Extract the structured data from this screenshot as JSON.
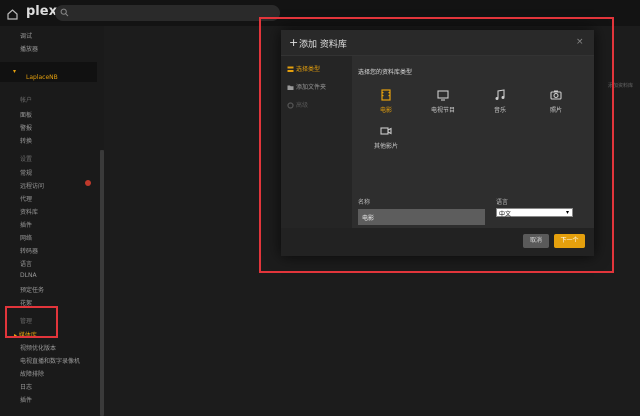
{
  "topbar": {
    "logo": "plex"
  },
  "sidebar": {
    "top_items": [
      "调试",
      "播放器"
    ],
    "server": "LaplaceNB",
    "section1": {
      "header": "帐户",
      "items": [
        "面板",
        "警报",
        "转换"
      ]
    },
    "section2": {
      "header": "设置",
      "items": [
        "常规",
        "远程访问",
        "代理",
        "资料库",
        "插件",
        "网络",
        "转码器",
        "语言",
        "DLNA",
        "预定任务",
        "花絮"
      ]
    },
    "section3": {
      "header": "管理",
      "items": [
        "媒体库",
        "视频优化版本",
        "电视直播和数字录像机",
        "故障排除",
        "日志",
        "插件"
      ]
    }
  },
  "right_caption": "添加资料库",
  "dialog": {
    "title": "添加 资料库",
    "close": "×",
    "nav": [
      "选择类型",
      "添加文件夹",
      "高级"
    ],
    "section_label": "选择您的资料库类型",
    "types": [
      {
        "label": "电影",
        "icon": "film-icon"
      },
      {
        "label": "电视节目",
        "icon": "tv-icon"
      },
      {
        "label": "音乐",
        "icon": "music-icon"
      },
      {
        "label": "照片",
        "icon": "camera-icon"
      },
      {
        "label": "其他影片",
        "icon": "video-icon"
      }
    ],
    "name_label": "名称",
    "name_value": "电影",
    "lang_label": "语言",
    "lang_value": "中文",
    "cancel": "取消",
    "next": "下一个"
  },
  "colors": {
    "accent": "#e5a00d",
    "highlight": "#e2353b"
  }
}
